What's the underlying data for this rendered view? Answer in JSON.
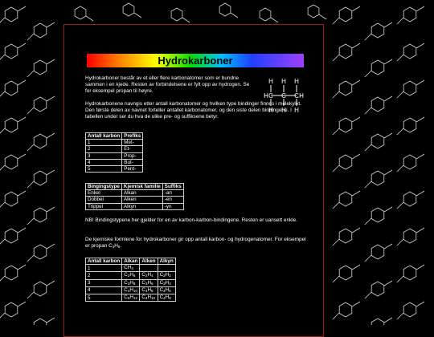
{
  "page": {
    "title": "Hydrokarboner",
    "intro": "Hydrokarboner består av et eller flere karbonatomer som er bundne sammen i en kjede. Resten av forbindelsene er fylt opp av hydrogen. Se for eksempel propan til høyre.",
    "naming": "Hydrokarbonene navngis etter antall karbonatomer og hvilken type bindinger finnes i molekylet. Den første delen av navnet forteller antallet karbonatomer, og den siste delen bindingene. I tabellen under ser du hva de ulike pre- og suffiksene betyr.",
    "note": "NB! Bindingstypene her gjelder for en av karbon-karbon-bindingene. Resten er uansett enkle.",
    "formula_intro": "De kjemiske formlene for hydrokarboner gir opp antall karbon- og hydrogenatomer. For eksempel er propan C",
    "formula_example_c": "3",
    "formula_example_h": "H",
    "formula_example_hn": "8",
    "formula_end": ".",
    "propan_atoms": {
      "h": "H",
      "c": "C"
    }
  },
  "prefix_table": {
    "headers": [
      "Antall karbon",
      "Prefiks"
    ],
    "rows": [
      [
        "1",
        "Met-"
      ],
      [
        "2",
        "Et-"
      ],
      [
        "3",
        "Prop-"
      ],
      [
        "4",
        "But-"
      ],
      [
        "5",
        "Pent-"
      ]
    ]
  },
  "suffix_table": {
    "headers": [
      "Bingingstype",
      "Kjemisk familie",
      "Suffiks"
    ],
    "rows": [
      [
        "Enkel",
        "Alkan",
        "-an"
      ],
      [
        "Dobbel",
        "Alken",
        "-en"
      ],
      [
        "Trippel",
        "Alkyn",
        "-yn"
      ]
    ]
  },
  "formula_table": {
    "headers": [
      "Antall karbon",
      "Alkan",
      "Alken",
      "Alkyn"
    ],
    "rows": [
      {
        "n": "1",
        "alkan": [
          [
            "C",
            ""
          ],
          [
            "H",
            "4"
          ]
        ],
        "alken": [],
        "alkyn": []
      },
      {
        "n": "2",
        "alkan": [
          [
            "C",
            "2"
          ],
          [
            "H",
            "6"
          ]
        ],
        "alken": [
          [
            "C",
            "2"
          ],
          [
            "H",
            "4"
          ]
        ],
        "alkyn": [
          [
            "C",
            "2"
          ],
          [
            "H",
            "2"
          ]
        ]
      },
      {
        "n": "3",
        "alkan": [
          [
            "C",
            "3"
          ],
          [
            "H",
            "8"
          ]
        ],
        "alken": [
          [
            "C",
            "3"
          ],
          [
            "H",
            "6"
          ]
        ],
        "alkyn": [
          [
            "C",
            "3"
          ],
          [
            "H",
            "4"
          ]
        ]
      },
      {
        "n": "4",
        "alkan": [
          [
            "C",
            "4"
          ],
          [
            "H",
            "10"
          ]
        ],
        "alken": [
          [
            "C",
            "4"
          ],
          [
            "H",
            "8"
          ]
        ],
        "alkyn": [
          [
            "C",
            "4"
          ],
          [
            "H",
            "6"
          ]
        ]
      },
      {
        "n": "5",
        "alkan": [
          [
            "C",
            "5"
          ],
          [
            "H",
            "12"
          ]
        ],
        "alken": [
          [
            "C",
            "4"
          ],
          [
            "H",
            "10"
          ]
        ],
        "alkyn": [
          [
            "C",
            "4"
          ],
          [
            "H",
            "8"
          ]
        ]
      }
    ]
  },
  "colors": {
    "frame_border": "#a01818",
    "text": "#ffffff",
    "background": "#000000"
  }
}
